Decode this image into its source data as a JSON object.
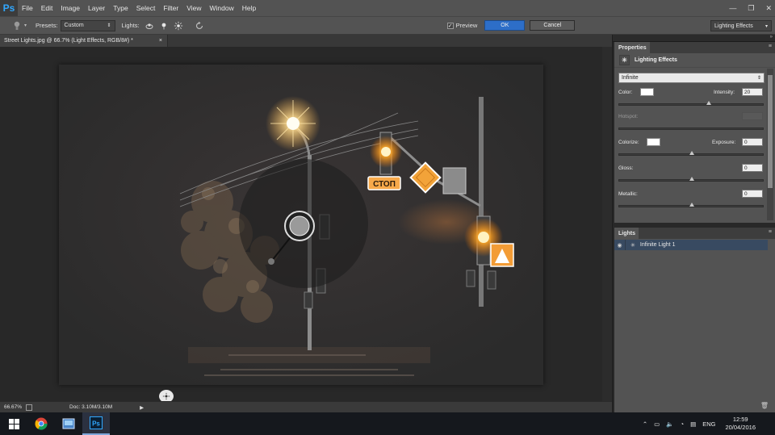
{
  "app": {
    "logo": "Ps"
  },
  "menu": [
    "File",
    "Edit",
    "Image",
    "Layer",
    "Type",
    "Select",
    "Filter",
    "View",
    "Window",
    "Help"
  ],
  "window_controls": {
    "minimize": "—",
    "restore": "❐",
    "close": "✕"
  },
  "options_bar": {
    "presets_label": "Presets:",
    "presets_value": "Custom",
    "lights_label": "Lights:",
    "preview_label": "Preview",
    "preview_checked": true,
    "ok_label": "OK",
    "cancel_label": "Cancel",
    "workspace": "Lighting Effects"
  },
  "document": {
    "tab_title": "Street Lights.jpg @ 66.7% (Light Effects, RGB/8#) *",
    "tab_close": "×",
    "sign_text": "СТОП"
  },
  "status": {
    "zoom": "66.67%",
    "doc": "Doc: 3.10M/3.10M",
    "arrow": "▶"
  },
  "properties": {
    "tab": "Properties",
    "header": "Lighting Effects",
    "light_type": "Infinite",
    "color_label": "Color:",
    "color": "#ffffff",
    "intensity_label": "Intensity:",
    "intensity": "20",
    "hotspot_label": "Hotspot:",
    "colorize_label": "Colorize:",
    "colorize_color": "#ffffff",
    "exposure_label": "Exposure:",
    "exposure": "0",
    "gloss_label": "Gloss:",
    "gloss": "0",
    "metallic_label": "Metallic:",
    "metallic": "0"
  },
  "lights_panel": {
    "tab": "Lights",
    "items": [
      "Infinite Light 1"
    ]
  },
  "taskbar": {
    "language": "ENG",
    "time": "12:59",
    "date": "20/04/2016"
  },
  "colors": {
    "accent": "#2d6ec8",
    "lamp": "#ffa726",
    "selection": "#384a61"
  }
}
